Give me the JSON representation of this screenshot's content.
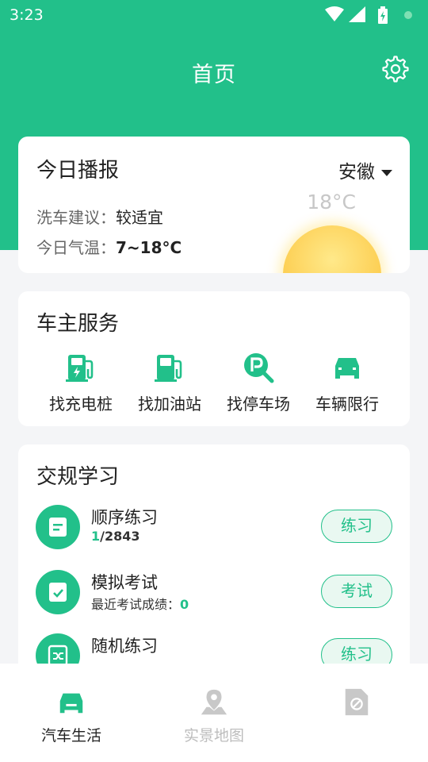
{
  "status_bar": {
    "time": "3:23"
  },
  "header": {
    "title": "首页"
  },
  "today_card": {
    "title": "今日播报",
    "region": "安徽",
    "temperature": "18°C",
    "wash_label": "洗车建议：",
    "wash_value": "较适宜",
    "temp_label": "今日气温：",
    "temp_value": "7~18°C"
  },
  "service_card": {
    "title": "车主服务",
    "items": [
      {
        "label": "找充电桩",
        "icon": "charging-station-icon"
      },
      {
        "label": "找加油站",
        "icon": "gas-station-icon"
      },
      {
        "label": "找停车场",
        "icon": "parking-search-icon"
      },
      {
        "label": "车辆限行",
        "icon": "car-icon"
      }
    ]
  },
  "study_card": {
    "title": "交规学习",
    "rows": [
      {
        "name": "顺序练习",
        "progress_current": "1",
        "progress_total": "/2843",
        "button": "练习",
        "icon": "document-icon"
      },
      {
        "name": "模拟考试",
        "sub_label": "最近考试成绩：",
        "sub_value": "0",
        "button": "考试",
        "icon": "checklist-icon"
      },
      {
        "name": "随机练习",
        "button": "练习",
        "icon": "shuffle-icon"
      }
    ]
  },
  "bottom_nav": {
    "items": [
      {
        "label": "汽车生活",
        "active": true,
        "icon": "car-icon"
      },
      {
        "label": "实景地图",
        "active": false,
        "icon": "map-pin-icon"
      },
      {
        "label": "",
        "active": false,
        "icon": "blocked-file-icon"
      }
    ]
  },
  "colors": {
    "primary": "#22c08a",
    "background": "#f4f5f7",
    "sun": "#fdd25a"
  }
}
